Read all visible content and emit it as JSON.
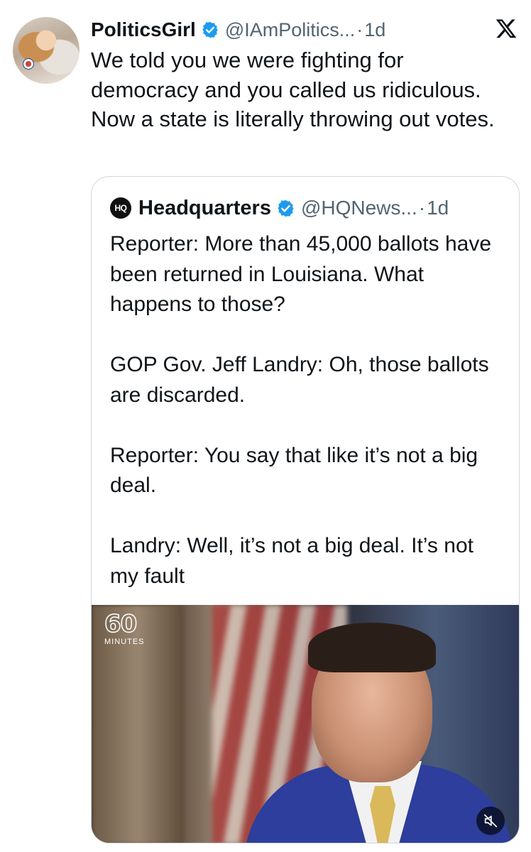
{
  "post": {
    "author_name": "PoliticsGirl",
    "author_handle": "@IAmPolitics...",
    "separator": "·",
    "time": "1d",
    "text": "We told you we were fighting for democracy and you called us ridiculous. Now a state is literally throwing out votes.",
    "platform_icon": "x-logo-icon"
  },
  "quote": {
    "logo_text": "HQ",
    "author_name": "Headquarters",
    "author_handle": "@HQNews...",
    "separator": "·",
    "time": "1d",
    "paragraphs": [
      "Reporter: More than 45,000 ballots have been returned in Louisiana. What happens to those?",
      "GOP Gov. Jeff Landry: Oh, those ballots are discarded.",
      "Reporter: You say that like it’s not a big deal.",
      "Landry: Well, it’s not a big deal. It’s not my fault"
    ],
    "media": {
      "watermark_number": "60",
      "watermark_label": "MINUTES",
      "mute_icon": "speaker-muted-icon"
    }
  },
  "colors": {
    "text": "#0f1419",
    "secondary": "#536471",
    "verified": "#1d9bf0",
    "border": "#cfd9de"
  }
}
